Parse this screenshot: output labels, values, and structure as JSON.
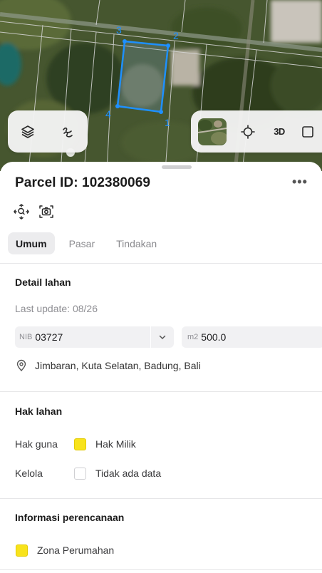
{
  "map": {
    "vertex_labels": [
      "1",
      "2",
      "3",
      "4"
    ],
    "controls_left": [
      {
        "icon": "layers-icon"
      },
      {
        "icon": "draw-path-icon"
      }
    ],
    "controls_right": [
      {
        "icon": "basemap-thumbnail"
      },
      {
        "icon": "crosshair-icon"
      },
      {
        "icon": "3d-toggle",
        "label": "3D"
      },
      {
        "icon": "fullscreen-icon"
      }
    ],
    "colors": {
      "parcel_outline": "#1e90ff",
      "vertex_label": "#1e90ff"
    }
  },
  "sheet": {
    "title": "Parcel ID: 102380069",
    "more_label": "•••",
    "tools": [
      {
        "icon": "zoom-to-parcel-icon"
      },
      {
        "icon": "screenshot-icon"
      }
    ],
    "tabs": [
      {
        "label": "Umum",
        "active": true
      },
      {
        "label": "Pasar",
        "active": false
      },
      {
        "label": "Tindakan",
        "active": false
      }
    ],
    "detail": {
      "heading": "Detail lahan",
      "last_update": "Last update: 08/26",
      "nib_prefix": "NIB",
      "nib_value": "03727",
      "area_prefix": "m2",
      "area_value": "500.0",
      "location": "Jimbaran, Kuta Selatan, Badung, Bali"
    },
    "rights": {
      "heading": "Hak lahan",
      "rows": [
        {
          "label": "Hak guna",
          "value": "Hak Milik",
          "swatch": "#f8e31c"
        },
        {
          "label": "Kelola",
          "value": "Tidak ada data",
          "swatch": "#ffffff"
        }
      ]
    },
    "planning": {
      "heading": "Informasi perencanaan",
      "zone": "Zona Perumahan",
      "zone_color": "#f8e31c"
    }
  }
}
